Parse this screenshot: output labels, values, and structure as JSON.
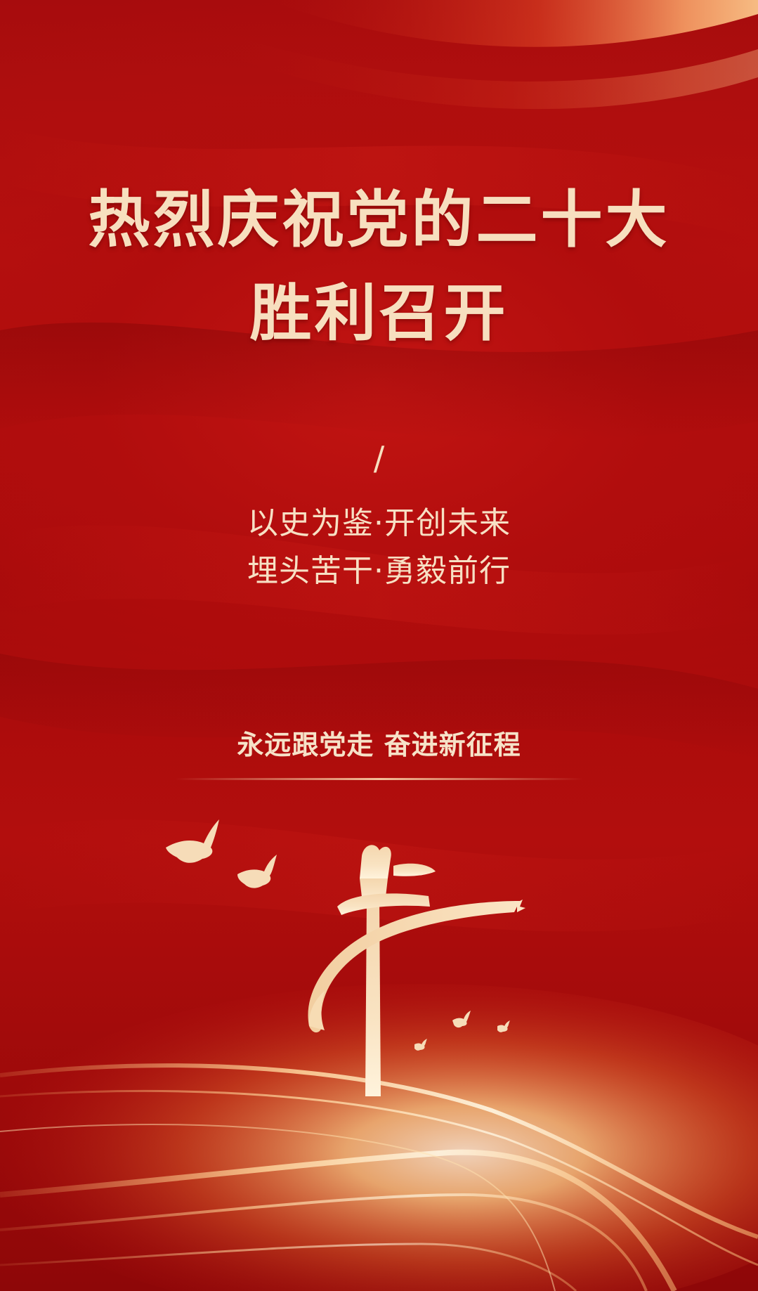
{
  "poster": {
    "title_line_1": "热烈庆祝党的二十大",
    "title_line_2": "胜利召开",
    "divider_glyph": "/",
    "slogan_line_1": "以史为鉴·开创未来",
    "slogan_line_2": "埋头苦干·勇毅前行",
    "tagline": "永远跟党走 奋进新征程"
  },
  "colors": {
    "background_red": "#b10d0d",
    "gold_text": "#f7dfbf",
    "gold_glow": "#ffd79a"
  },
  "icons": [
    "dove-icon",
    "huabiao-pillar-icon",
    "ribbon-icon"
  ]
}
